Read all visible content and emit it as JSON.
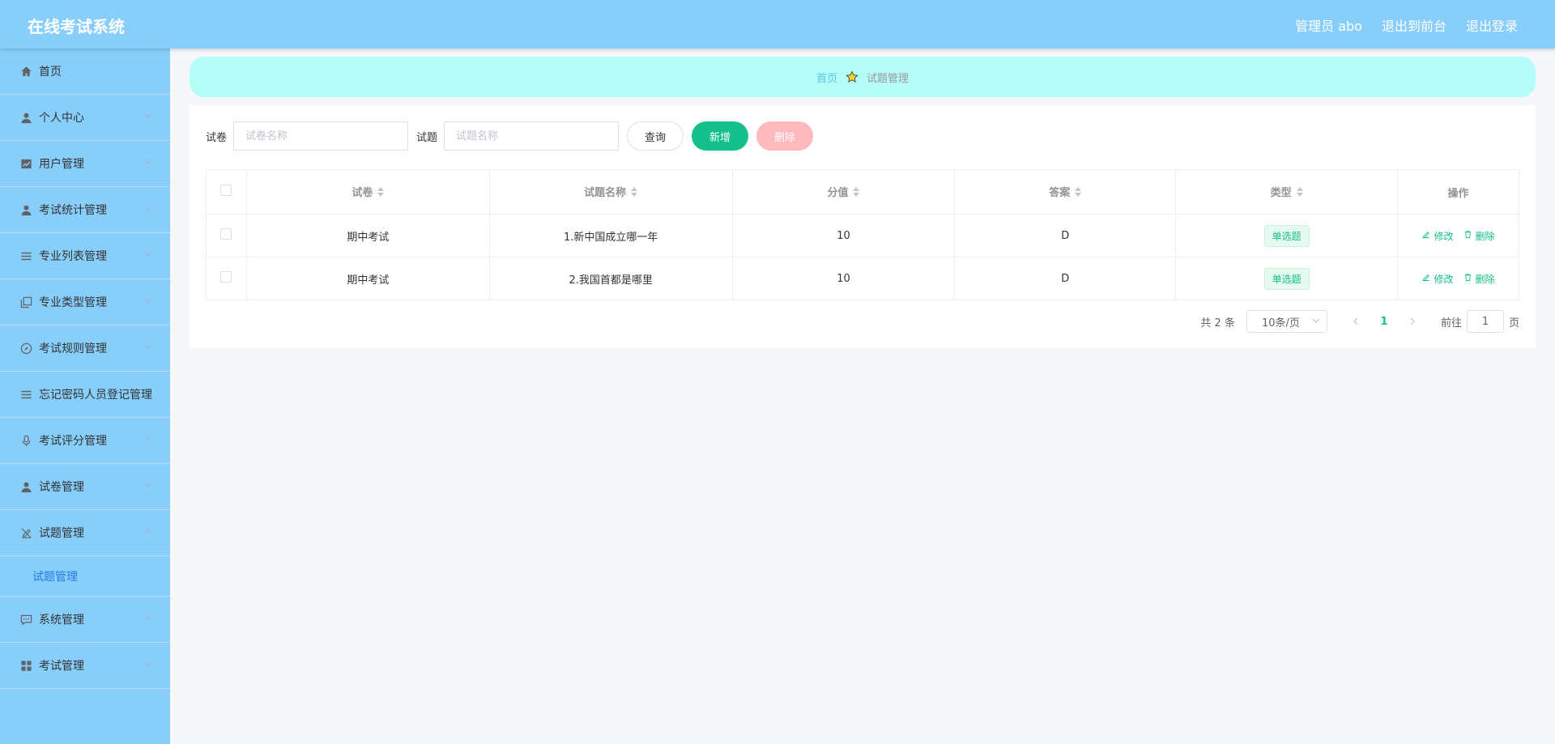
{
  "header": {
    "title": "在线考试系统",
    "user_label": "管理员 abo",
    "exit_front_label": "退出到前台",
    "logout_label": "退出登录"
  },
  "sidebar": {
    "items": [
      {
        "label": "首页",
        "icon": "home-icon",
        "has_arrow": false
      },
      {
        "label": "个人中心",
        "icon": "user-icon",
        "has_arrow": true
      },
      {
        "label": "用户管理",
        "icon": "chart-icon",
        "has_arrow": true
      },
      {
        "label": "考试统计管理",
        "icon": "user-icon",
        "has_arrow": true
      },
      {
        "label": "专业列表管理",
        "icon": "list-icon",
        "has_arrow": true
      },
      {
        "label": "专业类型管理",
        "icon": "copy-icon",
        "has_arrow": true
      },
      {
        "label": "考试规则管理",
        "icon": "compass-icon",
        "has_arrow": true
      },
      {
        "label": "忘记密码人员登记管理",
        "icon": "list-icon",
        "has_arrow": false
      },
      {
        "label": "考试评分管理",
        "icon": "microphone-icon",
        "has_arrow": true
      },
      {
        "label": "试卷管理",
        "icon": "user-icon",
        "has_arrow": true
      },
      {
        "label": "试题管理",
        "icon": "edit-off-icon",
        "has_arrow": true,
        "expanded": true
      },
      {
        "label": "系统管理",
        "icon": "chat-icon",
        "has_arrow": true
      },
      {
        "label": "考试管理",
        "icon": "grid-icon",
        "has_arrow": true
      }
    ],
    "submenu_label": "试题管理"
  },
  "breadcrumb": {
    "home": "首页",
    "current": "试题管理"
  },
  "search": {
    "paper_label": "试卷",
    "paper_placeholder": "试卷名称",
    "question_label": "试题",
    "question_placeholder": "试题名称",
    "query_label": "查询",
    "add_label": "新增",
    "delete_label": "删除"
  },
  "table": {
    "columns": [
      "试卷",
      "试题名称",
      "分值",
      "答案",
      "类型",
      "操作"
    ],
    "rows": [
      {
        "paper": "期中考试",
        "question": "1.新中国成立哪一年",
        "score": "10",
        "answer": "D",
        "type": "单选题"
      },
      {
        "paper": "期中考试",
        "question": "2.我国首都是哪里",
        "score": "10",
        "answer": "D",
        "type": "单选题"
      }
    ],
    "edit_label": "修改",
    "delete_label": "删除"
  },
  "pagination": {
    "total_text": "共 2 条",
    "page_size": "10条/页",
    "current_page": "1",
    "goto_prefix": "前往",
    "goto_value": "1",
    "goto_suffix": "页"
  },
  "colors": {
    "header_bg": "#87cefa",
    "sidebar_bg": "#87cefa",
    "breadcrumb_bg": "#b5fdf9",
    "accent_green": "#13c08b",
    "delete_pink": "#fdb9bb"
  }
}
